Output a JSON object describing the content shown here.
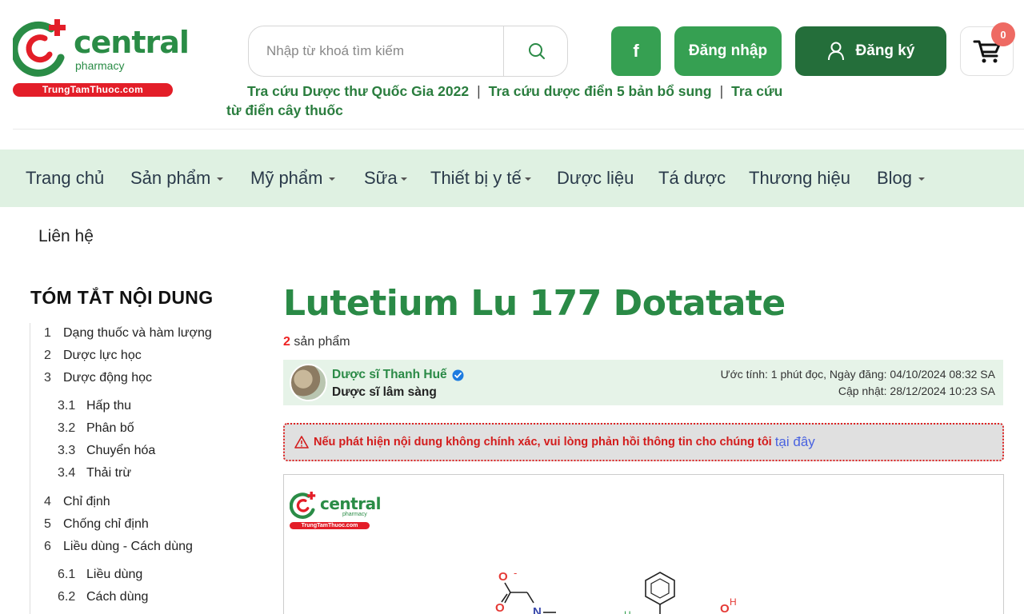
{
  "brand": {
    "name": "central",
    "tagline": "pharmacy",
    "domain": "TrungTamThuoc.com",
    "green": "#2a8c46",
    "red": "#e31e28"
  },
  "search": {
    "placeholder": "Nhập từ khoá tìm kiếm",
    "icon": "search-icon"
  },
  "header_buttons": {
    "facebook_label": "f",
    "login_label": "Đăng nhập",
    "register_label": "Đăng ký",
    "cart_count": "0"
  },
  "quick_links": [
    "Tra cứu Dược thư Quốc Gia 2022",
    "Tra cứu dược điển 5 bản bổ sung",
    "Tra cứu",
    "từ điển cây thuốc"
  ],
  "nav": {
    "items": [
      {
        "label": "Trang chủ"
      },
      {
        "label": "Sản phẩm"
      },
      {
        "label": "Mỹ phẩm"
      },
      {
        "label": "Sữa"
      },
      {
        "label": "Thiết bị y tế"
      },
      {
        "label": "Dược liệu"
      },
      {
        "label": "Tá dược"
      },
      {
        "label": "Thương hiệu"
      },
      {
        "label": "Blog"
      }
    ],
    "contact": "Liên hệ"
  },
  "toc": {
    "title": "TÓM TẮT NỘI DUNG",
    "items": [
      {
        "num": "1",
        "label": "Dạng thuốc và hàm lượng"
      },
      {
        "num": "2",
        "label": "Dược lực học"
      },
      {
        "num": "3",
        "label": "Dược động học"
      },
      {
        "num": "3.1",
        "label": "Hấp thu"
      },
      {
        "num": "3.2",
        "label": "Phân bố"
      },
      {
        "num": "3.3",
        "label": "Chuyển hóa"
      },
      {
        "num": "3.4",
        "label": "Thải trừ"
      },
      {
        "num": "4",
        "label": "Chỉ định"
      },
      {
        "num": "5",
        "label": "Chống chỉ định"
      },
      {
        "num": "6",
        "label": "Liều dùng - Cách dùng"
      },
      {
        "num": "6.1",
        "label": "Liều dùng"
      },
      {
        "num": "6.2",
        "label": "Cách dùng"
      }
    ]
  },
  "article": {
    "title": "Lutetium Lu 177 Dotatate",
    "product_count": "2",
    "product_suffix": "sản phẩm",
    "author_name": "Dược sĩ Thanh Huế",
    "author_role": "Dược sĩ lâm sàng",
    "meta_line1": "Ước tính: 1 phút đọc, Ngày đăng: 04/10/2024 08:32 SA",
    "meta_line2": "Cập nhật: 28/12/2024 10:23 SA",
    "alert_text": "Nếu phát hiện nội dung không chính xác, vui lòng phản hồi thông tin cho chúng tôi",
    "alert_link": "tại đây"
  },
  "figure": {
    "atom_o_minus": "O",
    "charge": "-",
    "atom_o": "O",
    "atom_n": "N",
    "atom_h": "H",
    "atom_oh_o": "O",
    "atom_oh_h": "H"
  }
}
